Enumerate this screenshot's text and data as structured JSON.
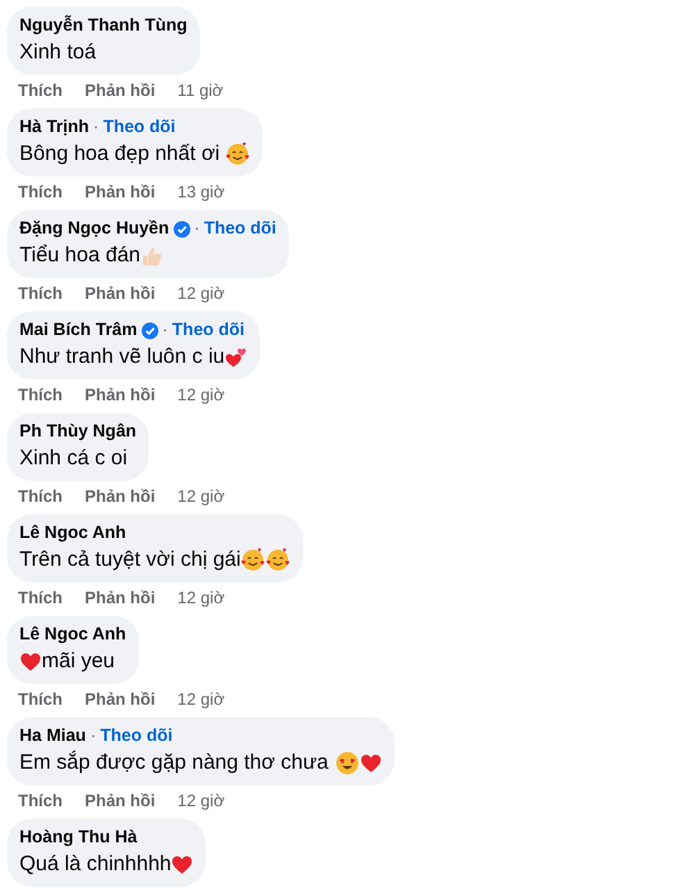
{
  "comments": [
    {
      "author": "Nguyễn Thanh Tùng",
      "text": "Xinh toá",
      "actions": [
        "Thích",
        "Phản hồi"
      ],
      "time": "11 giờ"
    },
    {
      "author": "Hà Trịnh",
      "separator": "·",
      "follow": "Theo dõi",
      "text": "Bông hoa đẹp nhất ơi ",
      "emojis": [
        {
          "kind": "hearts_face"
        }
      ],
      "actions": [
        "Thích",
        "Phản hồi"
      ],
      "time": "13 giờ"
    },
    {
      "author": "Đặng Ngọc Huyền",
      "verified": true,
      "separator": "·",
      "follow": "Theo dõi",
      "text": "Tiểu hoa đán",
      "emojis": [
        {
          "kind": "thumbs_up"
        }
      ],
      "actions": [
        "Thích",
        "Phản hồi"
      ],
      "time": "12 giờ"
    },
    {
      "author": "Mai Bích Trâm",
      "verified": true,
      "separator": "·",
      "follow": "Theo dõi",
      "text": "Như tranh vẽ luôn c iu",
      "emojis": [
        {
          "kind": "two_hearts"
        }
      ],
      "actions": [
        "Thích",
        "Phản hồi"
      ],
      "time": "12 giờ"
    },
    {
      "author": "Ph Thùy Ngân",
      "text": "Xinh cá c oi",
      "actions": [
        "Thích",
        "Phản hồi"
      ],
      "time": "12 giờ"
    },
    {
      "author": "Lê Ngoc Anh",
      "text": "Trên cả tuyệt vời chị gái",
      "emojis": [
        {
          "kind": "hearts_face"
        },
        {
          "kind": "hearts_face"
        }
      ],
      "actions": [
        "Thích",
        "Phản hồi"
      ],
      "time": "12 giờ"
    },
    {
      "author": "Lê Ngoc Anh",
      "text": "mãi yeu",
      "emoji_first": true,
      "emojis": [
        {
          "kind": "heart"
        }
      ],
      "actions": [
        "Thích",
        "Phản hồi"
      ],
      "time": "12 giờ"
    },
    {
      "author": "Ha Miau",
      "separator": "·",
      "follow": "Theo dõi",
      "text": "Em sắp được gặp nàng thơ chưa ",
      "emojis": [
        {
          "kind": "heart_eyes"
        },
        {
          "kind": "heart"
        }
      ],
      "actions": [
        "Thích",
        "Phản hồi"
      ],
      "time": "12 giờ"
    },
    {
      "author": "Hoàng Thu Hà",
      "text": "Quá là chinhhhh",
      "emojis": [
        {
          "kind": "heart"
        }
      ]
    }
  ]
}
